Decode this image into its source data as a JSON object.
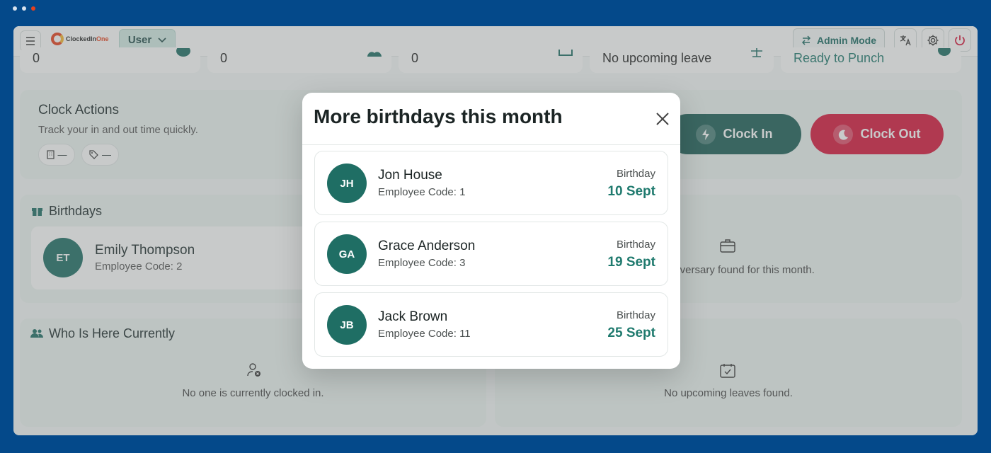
{
  "window": {
    "dot_colors": [
      "#cfd9e6",
      "#cfd9e6",
      "#e8401c"
    ]
  },
  "topbar": {
    "logo_part1": "ClockedIn",
    "logo_part2": "One",
    "user_select": "User",
    "admin_mode": "Admin Mode"
  },
  "stats": {
    "values": [
      "0",
      "0",
      "0",
      "No upcoming leave",
      "Ready to Punch"
    ]
  },
  "clock_actions": {
    "title": "Clock Actions",
    "subtitle": "Track your in and out time quickly.",
    "chip1": "—",
    "chip2": "—",
    "clock_in": "Clock In",
    "clock_out": "Clock Out"
  },
  "birthdays": {
    "title": "Birthdays",
    "person": {
      "initials": "ET",
      "name": "Emily Thompson",
      "code": "Employee Code: 2"
    }
  },
  "anniversary": {
    "note": "niversary found for this month."
  },
  "who_here": {
    "title": "Who Is Here Currently",
    "note": "No one is currently clocked in."
  },
  "leaves": {
    "note": "No upcoming leaves found."
  },
  "modal": {
    "title": "More birthdays this month",
    "items": [
      {
        "initials": "JH",
        "name": "Jon House",
        "code": "Employee Code: 1",
        "label": "Birthday",
        "date": "10 Sept"
      },
      {
        "initials": "GA",
        "name": "Grace Anderson",
        "code": "Employee Code: 3",
        "label": "Birthday",
        "date": "19 Sept"
      },
      {
        "initials": "JB",
        "name": "Jack Brown",
        "code": "Employee Code: 11",
        "label": "Birthday",
        "date": "25 Sept"
      }
    ]
  },
  "colors": {
    "accent": "#1f7a6e",
    "clock_in_bg": "#1a5e56",
    "clock_out_bg": "#d9163b",
    "brand_bg": "#04498a"
  }
}
